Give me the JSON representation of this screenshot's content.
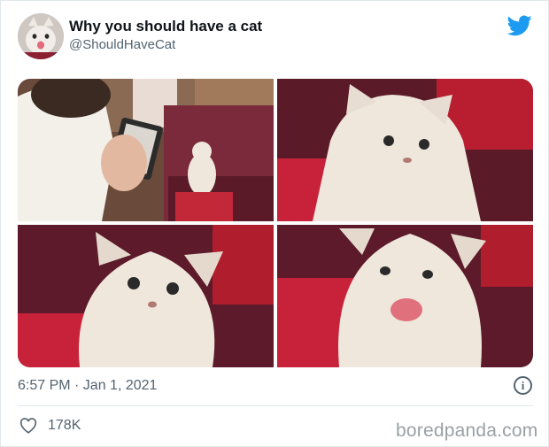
{
  "tweet": {
    "display_name": "Why you should have a cat",
    "handle": "@ShouldHaveCat",
    "timestamp": "6:57 PM · Jan 1, 2021",
    "likes": "178K",
    "info_glyph": "i"
  },
  "icons": {
    "logo": "twitter-bird-icon",
    "info": "info-icon",
    "like": "heart-icon"
  },
  "colors": {
    "brand": "#1d9bf0",
    "secondary_text": "#536471",
    "watermark": "#9aa0a4"
  },
  "watermark": "boredpanda.com"
}
